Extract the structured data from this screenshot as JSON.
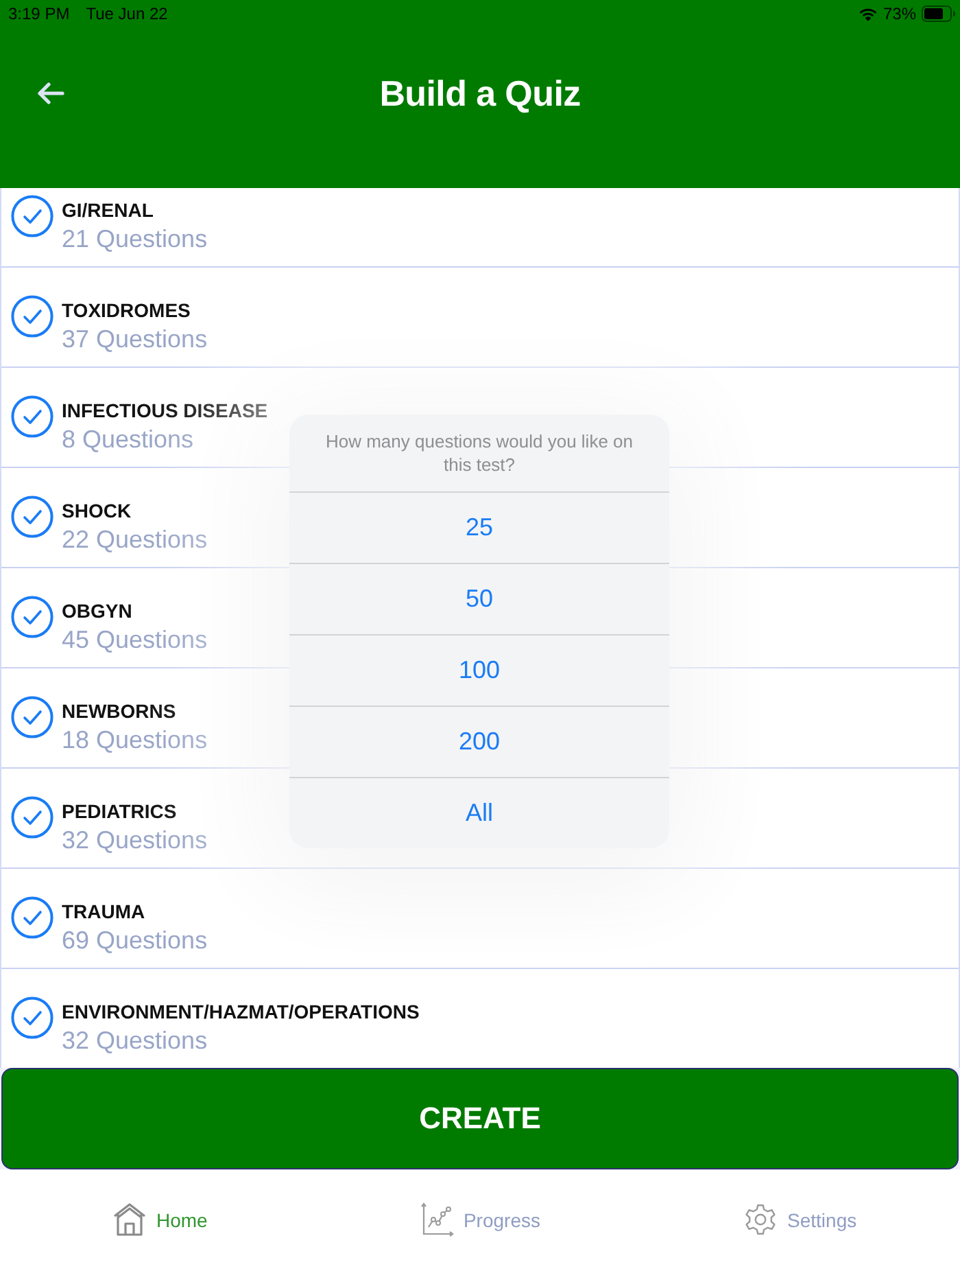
{
  "status_bar": {
    "time": "3:19 PM",
    "date": "Tue Jun 22",
    "battery": "73%"
  },
  "header": {
    "title": "Build a Quiz"
  },
  "categories": [
    {
      "name": "GI/RENAL",
      "count": "21 Questions",
      "selected": true
    },
    {
      "name": "TOXIDROMES",
      "count": "37 Questions",
      "selected": true
    },
    {
      "name": "INFECTIOUS DISEASE",
      "count": "8 Questions",
      "selected": true
    },
    {
      "name": "SHOCK",
      "count": "22 Questions",
      "selected": true
    },
    {
      "name": "OBGYN",
      "count": "45 Questions",
      "selected": true
    },
    {
      "name": "NEWBORNS",
      "count": "18 Questions",
      "selected": true
    },
    {
      "name": "PEDIATRICS",
      "count": "32 Questions",
      "selected": true
    },
    {
      "name": "TRAUMA",
      "count": "69 Questions",
      "selected": true
    },
    {
      "name": "ENVIRONMENT/HAZMAT/OPERATIONS",
      "count": "32 Questions",
      "selected": true
    }
  ],
  "create_button": {
    "label": "CREATE"
  },
  "dialog": {
    "message": "How many questions would you like on this test?",
    "options": [
      "25",
      "50",
      "100",
      "200",
      "All"
    ]
  },
  "tab_bar": [
    {
      "kind": "home",
      "label": "Home",
      "selected": true
    },
    {
      "kind": "progress",
      "label": "Progress",
      "selected": false
    },
    {
      "kind": "settings",
      "label": "Settings",
      "selected": false
    }
  ]
}
